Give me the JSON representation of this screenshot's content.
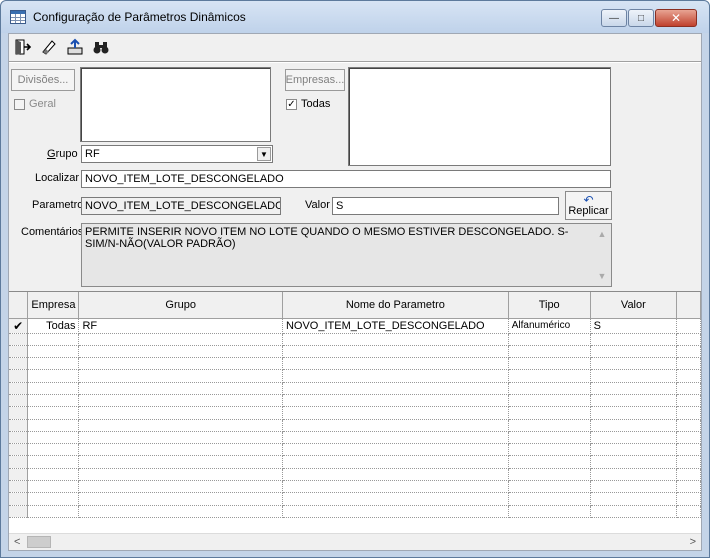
{
  "window": {
    "title": "Configuração de Parâmetros Dinâmicos",
    "minimize": "—",
    "maximize": "□",
    "close": "✕"
  },
  "toolbar": {
    "icons": [
      "exit-icon",
      "eraser-icon",
      "export-icon",
      "binoculars-icon"
    ]
  },
  "filters": {
    "divisoes_button": "Divisões...",
    "geral_label": "Geral",
    "geral_checked": false,
    "empresas_button": "Empresas...",
    "todas_label": "Todas",
    "todas_checked": true,
    "grupo_label": "Grupo",
    "grupo_value": "RF",
    "localizar_label": "Localizar",
    "localizar_value": "NOVO_ITEM_LOTE_DESCONGELADO",
    "parametro_label": "Parametro",
    "parametro_value": "NOVO_ITEM_LOTE_DESCONGELADO",
    "valor_label": "Valor",
    "valor_value": "S",
    "replicar_label": "Replicar",
    "comentarios_label": "Comentários",
    "comentarios_value": "PERMITE INSERIR NOVO ITEM NO LOTE QUANDO O MESMO ESTIVER DESCONGELADO. S-SIM/N-NÃO(VALOR PADRÃO)"
  },
  "grid": {
    "columns": [
      "Empresa",
      "Grupo",
      "Nome do Parametro",
      "Tipo",
      "Valor"
    ],
    "rows": [
      {
        "selected": "✔",
        "empresa": "Todas",
        "grupo": "RF",
        "nome": "NOVO_ITEM_LOTE_DESCONGELADO",
        "tipo": "Alfanumérico",
        "valor": "S"
      }
    ]
  },
  "scrollbar": {
    "left": "<",
    "right": ">"
  }
}
